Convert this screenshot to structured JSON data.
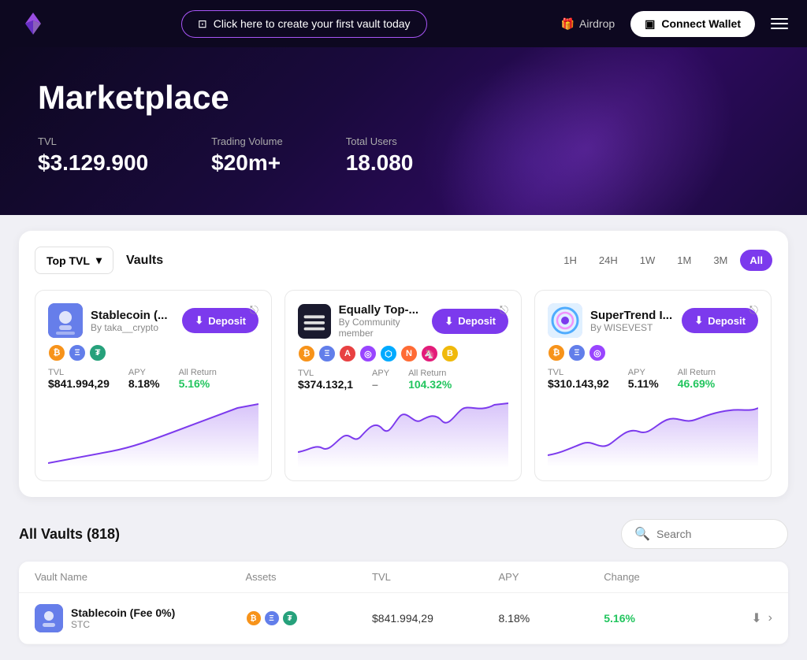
{
  "navbar": {
    "logo_alt": "Logo",
    "cta_label": "Click here to create your first vault today",
    "airdrop_label": "Airdrop",
    "connect_wallet_label": "Connect Wallet"
  },
  "hero": {
    "title": "Marketplace",
    "stats": [
      {
        "label": "TVL",
        "value": "$3.129.900"
      },
      {
        "label": "Trading Volume",
        "value": "$20m+"
      },
      {
        "label": "Total Users",
        "value": "18.080"
      }
    ]
  },
  "vaults_section": {
    "filter_label": "Top TVL",
    "section_title": "Vaults",
    "time_filters": [
      "1H",
      "24H",
      "1W",
      "1M",
      "3M",
      "All"
    ],
    "active_filter": "All",
    "cards": [
      {
        "name": "Stablecoin (...",
        "by": "By taka__crypto",
        "deposit_label": "Deposit",
        "tvl_label": "TVL",
        "tvl_value": "$841.994,29",
        "apy_label": "APY",
        "apy_value": "8.18%",
        "return_label": "All Return",
        "return_value": "5.16%",
        "return_positive": true
      },
      {
        "name": "Equally Top-...",
        "by": "By Community member",
        "deposit_label": "Deposit",
        "tvl_label": "TVL",
        "tvl_value": "$374.132,1",
        "apy_label": "APY",
        "apy_value": "–",
        "return_label": "All Return",
        "return_value": "104.32%",
        "return_positive": true
      },
      {
        "name": "SuperTrend I...",
        "by": "By WISEVEST",
        "deposit_label": "Deposit",
        "tvl_label": "TVL",
        "tvl_value": "$310.143,92",
        "apy_label": "APY",
        "apy_value": "5.11%",
        "return_label": "All Return",
        "return_value": "46.69%",
        "return_positive": true
      }
    ]
  },
  "all_vaults": {
    "title": "All Vaults (818)",
    "search_placeholder": "Search",
    "columns": [
      "Vault Name",
      "Assets",
      "TVL",
      "APY",
      "Change",
      ""
    ],
    "rows": [
      {
        "name": "Stablecoin (Fee 0%)",
        "ticker": "STC",
        "tvl": "$841.994,29",
        "apy": "8.18%",
        "change": "5.16%",
        "change_positive": true
      }
    ]
  }
}
